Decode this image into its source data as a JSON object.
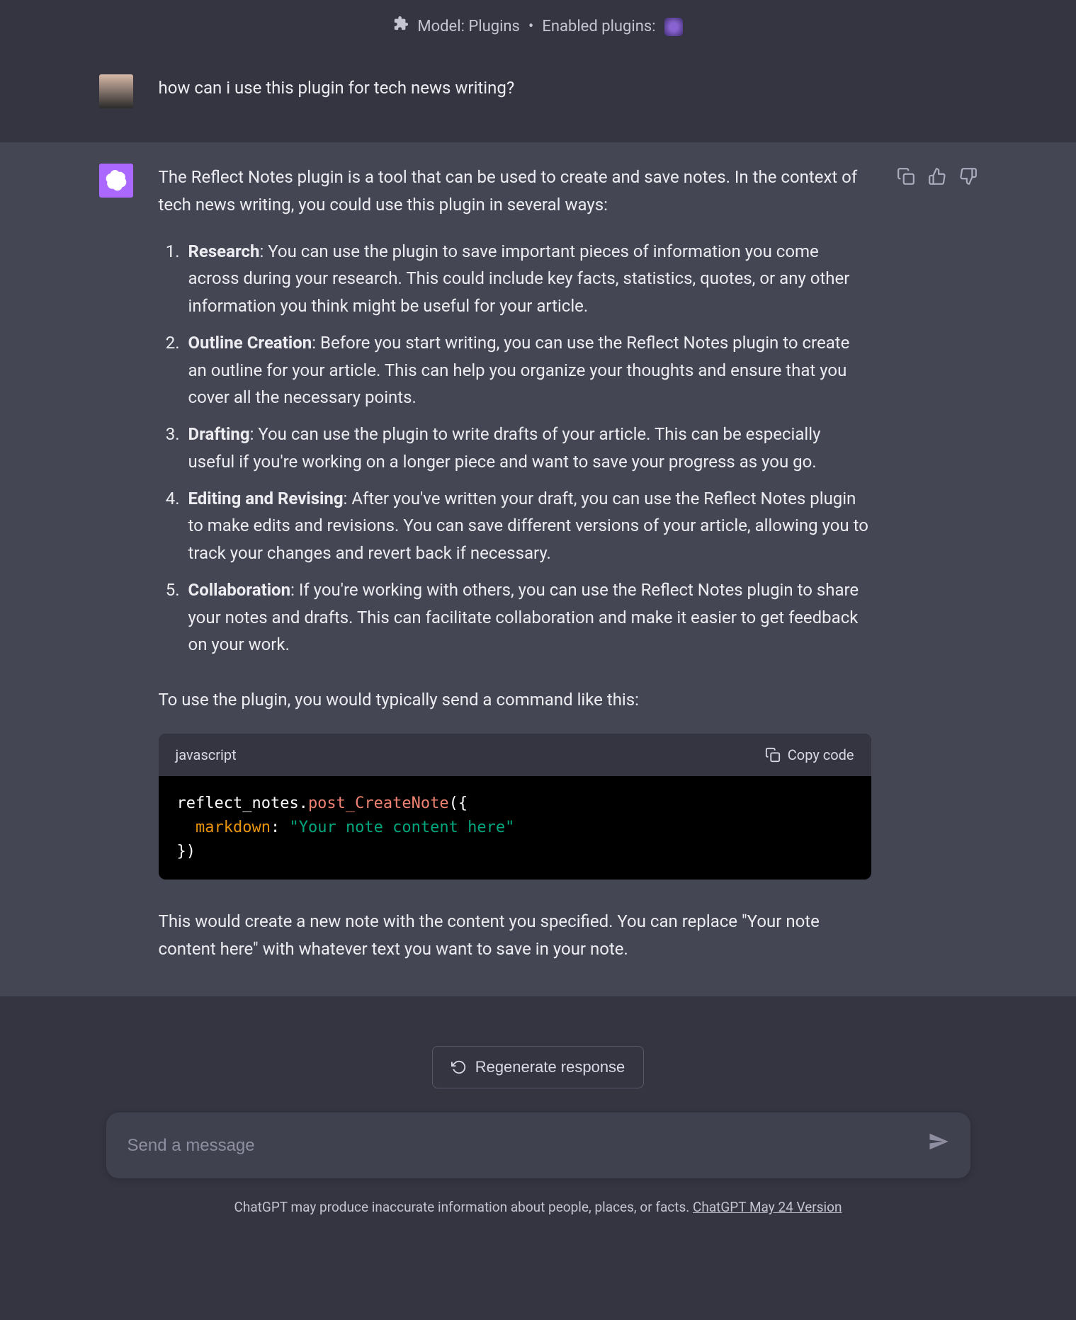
{
  "header": {
    "model_label": "Model: Plugins",
    "separator": "•",
    "enabled_label": "Enabled plugins:"
  },
  "user_message": {
    "text": "how can i use this plugin for tech news writing?"
  },
  "assistant_message": {
    "intro": "The Reflect Notes plugin is a tool that can be used to create and save notes. In the context of tech news writing, you could use this plugin in several ways:",
    "points": [
      {
        "title": "Research",
        "body": ": You can use the plugin to save important pieces of information you come across during your research. This could include key facts, statistics, quotes, or any other information you think might be useful for your article."
      },
      {
        "title": "Outline Creation",
        "body": ": Before you start writing, you can use the Reflect Notes plugin to create an outline for your article. This can help you organize your thoughts and ensure that you cover all the necessary points."
      },
      {
        "title": "Drafting",
        "body": ": You can use the plugin to write drafts of your article. This can be especially useful if you're working on a longer piece and want to save your progress as you go."
      },
      {
        "title": "Editing and Revising",
        "body": ": After you've written your draft, you can use the Reflect Notes plugin to make edits and revisions. You can save different versions of your article, allowing you to track your changes and revert back if necessary."
      },
      {
        "title": "Collaboration",
        "body": ": If you're working with others, you can use the Reflect Notes plugin to share your notes and drafts. This can facilitate collaboration and make it easier to get feedback on your work."
      }
    ],
    "after_list": "To use the plugin, you would typically send a command like this:",
    "code": {
      "language": "javascript",
      "copy_label": "Copy code",
      "line1_obj": "reflect_notes.",
      "line1_fn": "post_CreateNote",
      "line1_tail": "({",
      "line2_key": "markdown",
      "line2_colon": ": ",
      "line2_str": "\"Your note content here\"",
      "line3": "})"
    },
    "closing": "This would create a new note with the content you specified. You can replace \"Your note content here\" with whatever text you want to save in your note."
  },
  "controls": {
    "regenerate_label": "Regenerate response",
    "input_placeholder": "Send a message"
  },
  "footer": {
    "disclaimer_pre": "ChatGPT may produce inaccurate information about people, places, or facts. ",
    "version_link": "ChatGPT May 24 Version"
  }
}
